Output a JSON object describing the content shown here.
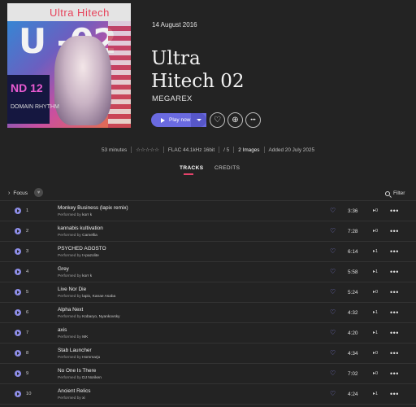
{
  "album": {
    "cover_text_top": "Ultra Hitech",
    "cover_text_big": "U -02",
    "cover_tag": "ND 12",
    "cover_tag2": "DOMAIN RHYTHM",
    "date": "14 August 2016",
    "title_line1": "Ultra",
    "title_line2": "Hitech 02",
    "artist": "MEGAREX"
  },
  "actions": {
    "play_label": "Play now",
    "favorite_icon": "♡",
    "add_icon": "⊕",
    "more_icon": "•••"
  },
  "meta": {
    "duration": "53 minutes",
    "rating": "☆☆☆☆☆",
    "quality": "FLAC 44.1kHz 16bit",
    "count": "/ 5",
    "images": "2 Images",
    "added": "Added 20 July 2025"
  },
  "tabs": [
    {
      "label": "TRACKS"
    },
    {
      "label": "CREDITS"
    }
  ],
  "toolbar": {
    "focus_label": "Focus",
    "filter_label": "Filter"
  },
  "performed_by_label": "Performed by",
  "tracks": [
    {
      "num": "1",
      "title": "Monkey Business (lapix remix)",
      "performers": "korr k",
      "duration": "3:36",
      "plays": "0"
    },
    {
      "num": "2",
      "title": "kannabis kultivation",
      "performers": "Camellia",
      "duration": "7:28",
      "plays": "0"
    },
    {
      "num": "3",
      "title": "PSYCHED AGOSTO",
      "performers": "t+pazolite",
      "duration": "6:14",
      "plays": "1"
    },
    {
      "num": "4",
      "title": "Grey",
      "performers": "korr k",
      "duration": "5:58",
      "plays": "1"
    },
    {
      "num": "5",
      "title": "Live Nor Die",
      "performers": "lapix, Kanae Asaba",
      "duration": "5:24",
      "plays": "0"
    },
    {
      "num": "6",
      "title": "Alpha Next",
      "performers": "Kobaryo, Nyankovsky",
      "duration": "4:32",
      "plays": "1"
    },
    {
      "num": "7",
      "title": "axis",
      "performers": "MK",
      "duration": "4:20",
      "plays": "1"
    },
    {
      "num": "8",
      "title": "Stab Launcher",
      "performers": "Hommarju",
      "duration": "4:34",
      "plays": "0"
    },
    {
      "num": "9",
      "title": "No One Is There",
      "performers": "DJ Noriken",
      "duration": "7:02",
      "plays": "0"
    },
    {
      "num": "10",
      "title": "Ancient Relics",
      "performers": "xi",
      "duration": "4:24",
      "plays": "1"
    }
  ]
}
